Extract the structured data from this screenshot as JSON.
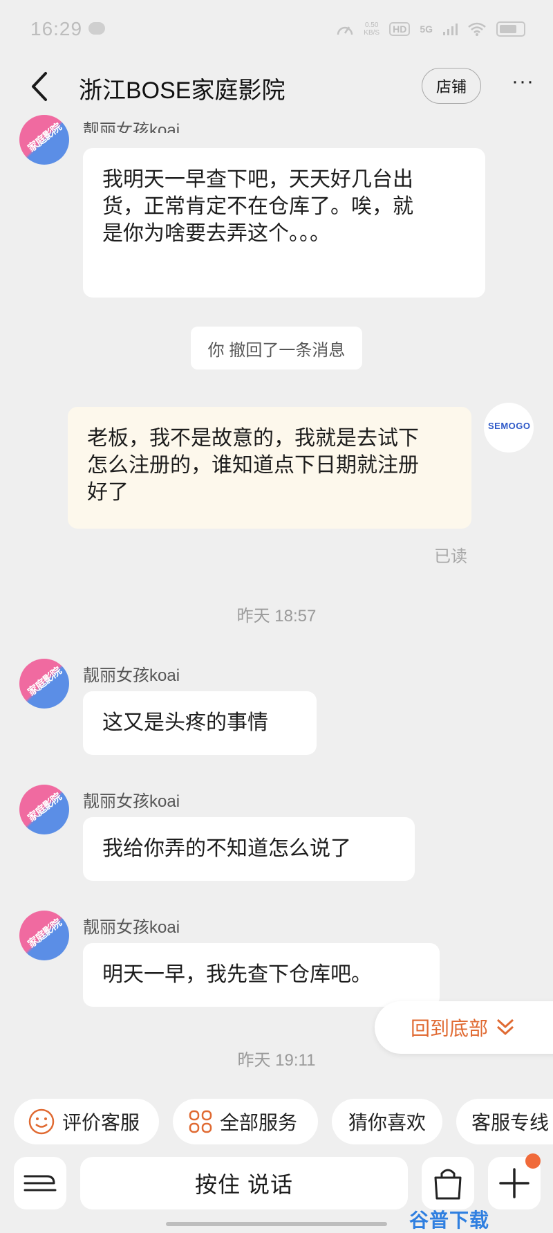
{
  "status_bar": {
    "time": "16:29",
    "net_speed_value": "0.50",
    "net_speed_unit": "KB/S",
    "hd_badge": "HD",
    "signal_label": "5G"
  },
  "header": {
    "title": "浙江BOSE家庭影院",
    "shop_label": "店铺",
    "more_label": "···"
  },
  "agent": {
    "avatar_text": "家庭影院"
  },
  "self": {
    "avatar_text": "SEMOGO"
  },
  "messages": {
    "m1_nick": "靓丽女孩koai",
    "m1_text": "我明天一早查下吧，天天好几台出货，正常肯定不在仓库了。唉，就是你为啥要去弄这个。。。",
    "recall_notice": "你 撤回了一条消息",
    "m2_text": "老板，我不是故意的，我就是去试下怎么注册的，谁知道点下日期就注册好了",
    "m2_status": "已读",
    "time_1": "昨天  18:57",
    "m3_nick": "靓丽女孩koai",
    "m3_text": "这又是头疼的事情",
    "m4_nick": "靓丽女孩koai",
    "m4_text": "我给你弄的不知道怎么说了",
    "m5_nick": "靓丽女孩koai",
    "m5_text": "明天一早，我先查下仓库吧。",
    "time_2": "昨天  19:11"
  },
  "jump_to_bottom_label": "回到底部",
  "quick_actions": {
    "rate": "评价客服",
    "all_services": "全部服务",
    "guess": "猜你喜欢",
    "hotline": "客服专线"
  },
  "input_bar": {
    "voice_label": "按住 说话"
  },
  "watermark": "谷普下载",
  "colors": {
    "accent": "#e06a32",
    "background": "#efefef",
    "self_bubble": "#fdf8ec",
    "badge": "#f06a3a"
  }
}
